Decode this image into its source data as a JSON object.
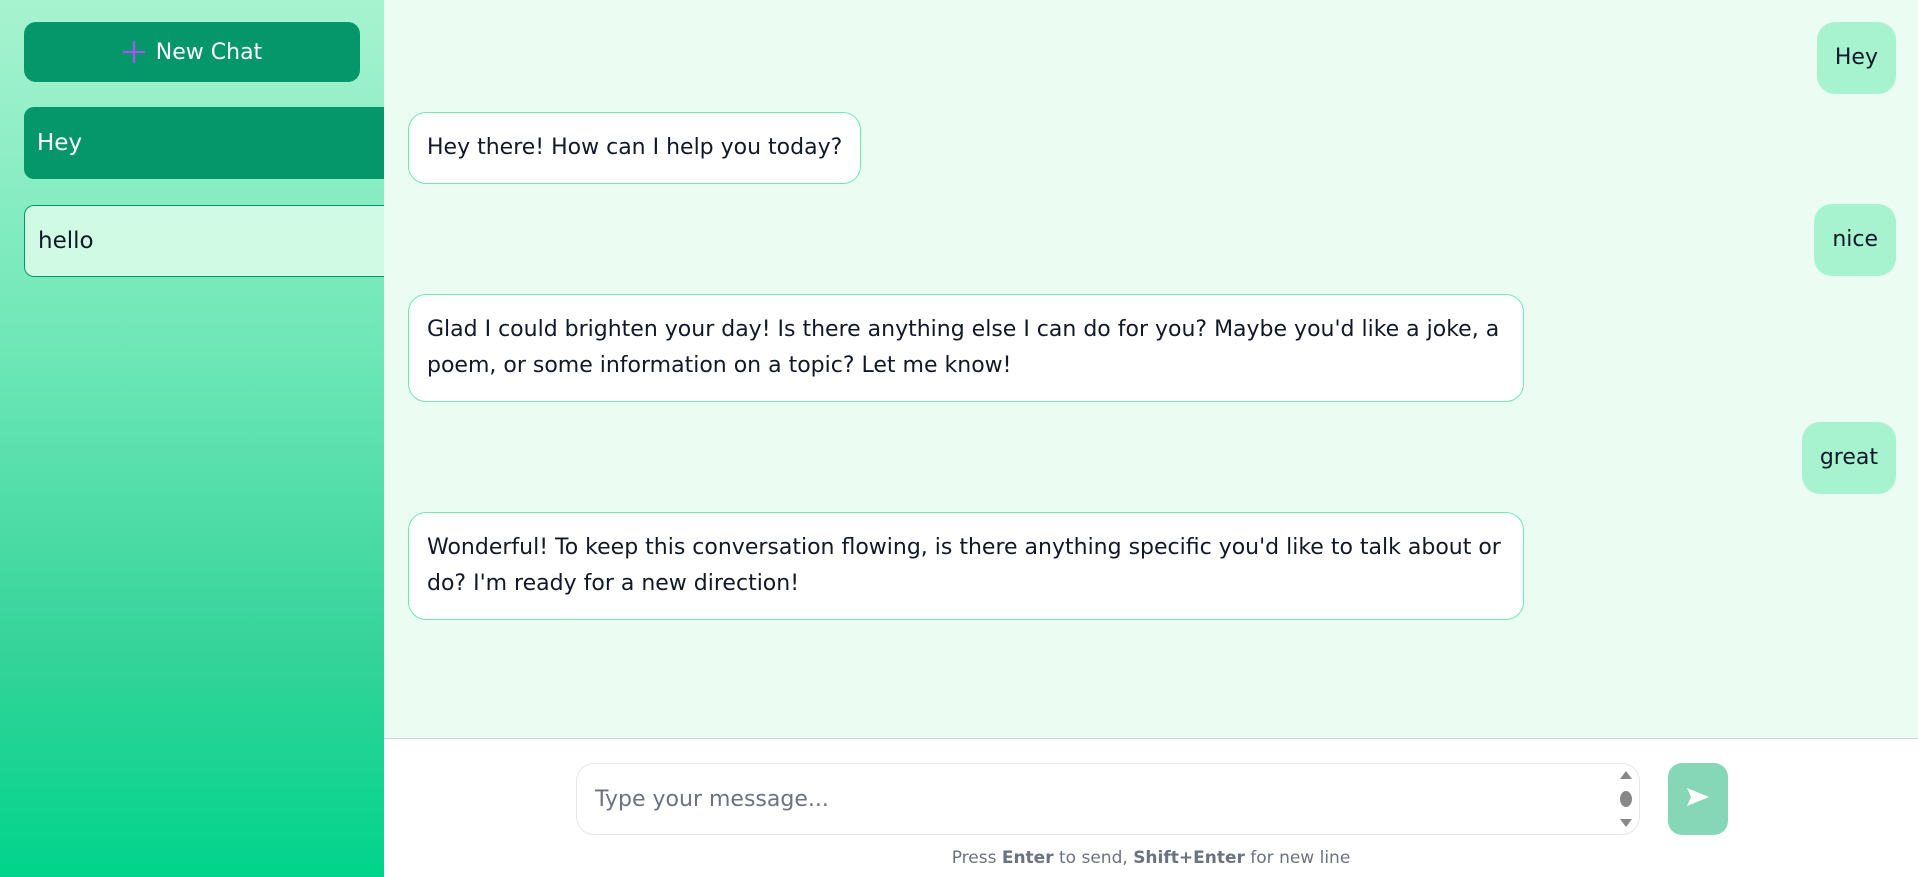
{
  "sidebar": {
    "new_chat_label": "New Chat",
    "new_chat_icon": "plus-icon",
    "chats": [
      {
        "label": "Hey",
        "active": true
      },
      {
        "label": "hello",
        "active": false
      }
    ]
  },
  "messages": [
    {
      "role": "user",
      "text": "Hey"
    },
    {
      "role": "assistant",
      "text": "Hey there! How can I help you today?"
    },
    {
      "role": "user",
      "text": "nice"
    },
    {
      "role": "assistant",
      "text": "Glad I could brighten your day! Is there anything else I can do for you? Maybe you'd like a joke, a poem, or some information on a topic? Let me know!"
    },
    {
      "role": "user",
      "text": "great"
    },
    {
      "role": "assistant",
      "text": "Wonderful! To keep this conversation flowing, is there anything specific you'd like to talk about or do? I'm ready for a new direction!"
    }
  ],
  "composer": {
    "placeholder": "Type your message...",
    "value": "",
    "send_icon": "send-arrow-icon",
    "hint": {
      "prefix": "Press ",
      "key1": "Enter",
      "middle": " to send, ",
      "key2": "Shift+Enter",
      "suffix": " for new line"
    }
  },
  "colors": {
    "accent": "#059669",
    "user_bubble": "#a7f3d0",
    "bot_border": "#6ee7b7",
    "send_button": "#86d6b8",
    "plus_icon": "#a855f7"
  }
}
